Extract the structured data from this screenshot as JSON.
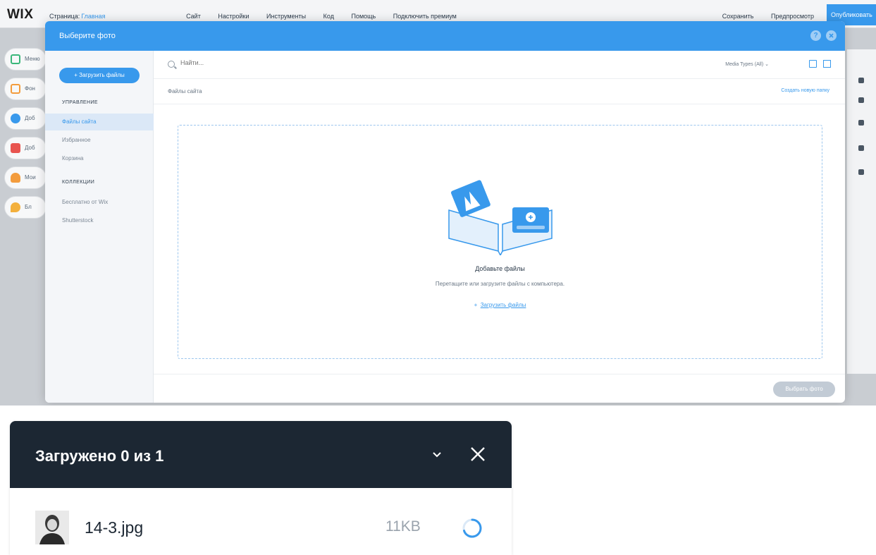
{
  "editor": {
    "logo": "WIX",
    "nav": [
      "Страница:",
      "Главная",
      "Сайт",
      "Настройки",
      "Инструменты",
      "Код",
      "Помощь",
      "Подключить премиум"
    ],
    "right": [
      "Сохранить",
      "Предпросмотр"
    ],
    "publish_label": "Опубликовать",
    "tools": [
      {
        "label": "Меню",
        "icon": "menu-icon",
        "color": "#3ab77a"
      },
      {
        "label": "Фон",
        "icon": "background-icon",
        "color": "#f39c3d"
      },
      {
        "label": "Доб",
        "icon": "add-icon",
        "color": "#3899ec"
      },
      {
        "label": "Доб",
        "icon": "apps-icon",
        "color": "#e8544f"
      },
      {
        "label": "Мои",
        "icon": "upload-icon",
        "color": "#f39c3d"
      },
      {
        "label": "Бл",
        "icon": "blog-icon",
        "color": "#f3b03d"
      }
    ]
  },
  "modal": {
    "title": "Выберите фото",
    "help_icon": "?",
    "upload_button": "+ Загрузить файлы",
    "manage_title": "УПРАВЛЕНИЕ",
    "manage_items": [
      "Файлы сайта",
      "Избранное",
      "Корзина"
    ],
    "collections_title": "КОЛЛЕКЦИИ",
    "collection_items": [
      "Бесплатно от Wix",
      "Shutterstock"
    ],
    "search_placeholder": "Найти...",
    "media_type": "Media Types (All) ⌄",
    "breadcrumb": "Файлы сайта",
    "new_folder": "Создать новую папку",
    "drop_title": "Добавьте файлы",
    "drop_subtitle": "Перетащите или загрузите файлы с компьютера.",
    "drop_link_plus": "+",
    "drop_link": "Загрузить файлы",
    "choose_button": "Выбрать фото"
  },
  "toast": {
    "title": "Загружено 0 из 1",
    "file": {
      "name": "14-3.jpg",
      "size": "11KB"
    }
  }
}
